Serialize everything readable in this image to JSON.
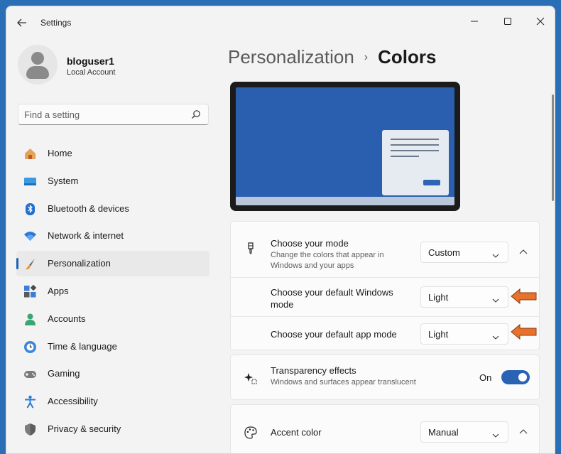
{
  "window": {
    "title": "Settings"
  },
  "profile": {
    "name": "bloguser1",
    "account_type": "Local Account"
  },
  "search": {
    "placeholder": "Find a setting"
  },
  "nav": [
    {
      "label": "Home",
      "icon": "home-icon",
      "active": false
    },
    {
      "label": "System",
      "icon": "system-icon",
      "active": false
    },
    {
      "label": "Bluetooth & devices",
      "icon": "bluetooth-icon",
      "active": false
    },
    {
      "label": "Network & internet",
      "icon": "wifi-icon",
      "active": false
    },
    {
      "label": "Personalization",
      "icon": "brush-icon",
      "active": true
    },
    {
      "label": "Apps",
      "icon": "apps-icon",
      "active": false
    },
    {
      "label": "Accounts",
      "icon": "accounts-icon",
      "active": false
    },
    {
      "label": "Time & language",
      "icon": "clock-globe-icon",
      "active": false
    },
    {
      "label": "Gaming",
      "icon": "gamepad-icon",
      "active": false
    },
    {
      "label": "Accessibility",
      "icon": "accessibility-icon",
      "active": false
    },
    {
      "label": "Privacy & security",
      "icon": "shield-icon",
      "active": false
    }
  ],
  "breadcrumb": {
    "parent": "Personalization",
    "separator": "›",
    "current": "Colors"
  },
  "mode": {
    "title": "Choose your mode",
    "description": "Change the colors that appear in Windows and your apps",
    "value": "Custom"
  },
  "windows_mode": {
    "title": "Choose your default Windows mode",
    "value": "Light"
  },
  "app_mode": {
    "title": "Choose your default app mode",
    "value": "Light"
  },
  "transparency": {
    "title": "Transparency effects",
    "description": "Windows and surfaces appear translucent",
    "state": "On",
    "enabled": true
  },
  "accent": {
    "title": "Accent color",
    "value": "Manual"
  },
  "colors": {
    "accent": "#2a62b4",
    "annotation_arrow": "#e8722c"
  }
}
